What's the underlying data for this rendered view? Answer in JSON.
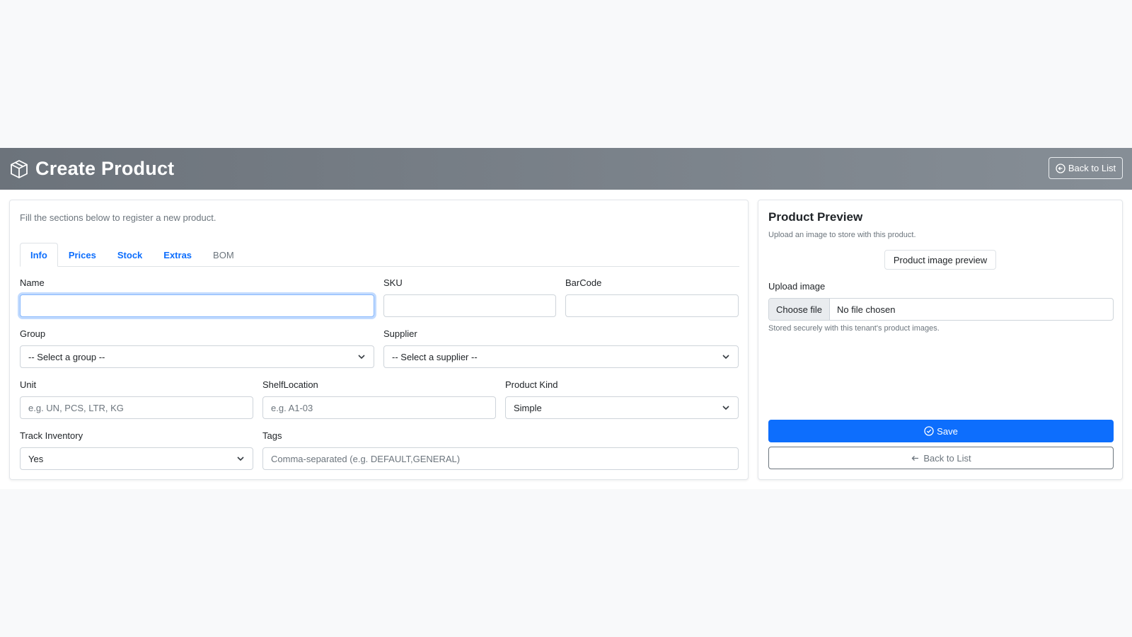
{
  "header": {
    "title": "Create Product",
    "title_icon": "box-icon",
    "back_label": "Back to List"
  },
  "form": {
    "intro": "Fill the sections below to register a new product.",
    "tabs": [
      {
        "label": "Info",
        "active": true
      },
      {
        "label": "Prices",
        "active": false
      },
      {
        "label": "Stock",
        "active": false
      },
      {
        "label": "Extras",
        "active": false
      },
      {
        "label": "BOM",
        "active": false
      }
    ],
    "fields": {
      "name": {
        "label": "Name",
        "value": ""
      },
      "sku": {
        "label": "SKU",
        "value": ""
      },
      "barcode": {
        "label": "BarCode",
        "value": ""
      },
      "group": {
        "label": "Group",
        "selected": "-- Select a group --"
      },
      "supplier": {
        "label": "Supplier",
        "selected": "-- Select a supplier --"
      },
      "unit": {
        "label": "Unit",
        "placeholder": "e.g. UN, PCS, LTR, KG"
      },
      "shelf": {
        "label": "ShelfLocation",
        "placeholder": "e.g. A1-03"
      },
      "kind": {
        "label": "Product Kind",
        "selected": "Simple"
      },
      "track": {
        "label": "Track Inventory",
        "selected": "Yes"
      },
      "tags": {
        "label": "Tags",
        "placeholder": "Comma-separated (e.g. DEFAULT,GENERAL)"
      }
    }
  },
  "preview": {
    "title": "Product Preview",
    "subtitle": "Upload an image to store with this product.",
    "image_alt": "Product image preview",
    "upload_label": "Upload image",
    "choose_file": "Choose file",
    "no_file": "No file chosen",
    "hint": "Stored securely with this tenant's product images.",
    "save_label": "Save",
    "back_label": "Back to List"
  },
  "colors": {
    "primary": "#0d6efd",
    "header_bg": "#6c737b",
    "page_bg": "#f8f9fa"
  }
}
